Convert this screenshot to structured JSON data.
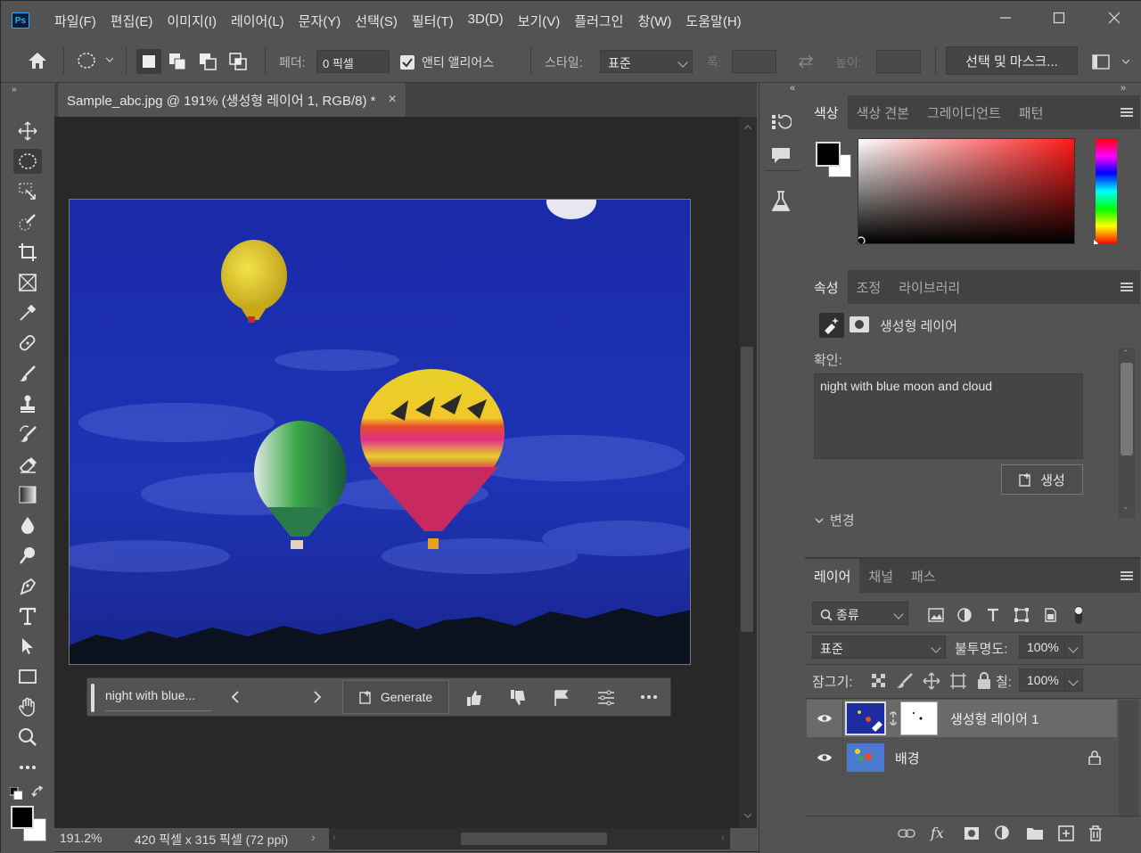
{
  "app": {
    "logo": "Ps",
    "menu": [
      "파일(F)",
      "편집(E)",
      "이미지(I)",
      "레이어(L)",
      "문자(Y)",
      "선택(S)",
      "필터(T)",
      "3D(D)",
      "보기(V)",
      "플러그인",
      "창(W)",
      "도움말(H)"
    ]
  },
  "options": {
    "feather_label": "페더:",
    "feather_value": "0 픽셀",
    "antialias_label": "앤티 앨리어스",
    "antialias_checked": true,
    "style_label": "스타일:",
    "style_value": "표준",
    "width_label": "폭:",
    "height_label": "높이:",
    "select_mask_button": "선택 및 마스크..."
  },
  "document": {
    "tab_title": "Sample_abc.jpg @ 191% (생성형 레이어 1, RGB/8) *",
    "zoom": "191.2%",
    "info": "420 픽셀 x 315 픽셀 (72 ppi)"
  },
  "generative_bar": {
    "prompt": "night with blue...",
    "generate_label": "Generate"
  },
  "color_panel": {
    "tabs": [
      "색상",
      "색상 견본",
      "그레이디언트",
      "패턴"
    ],
    "active_tab": 0,
    "hue_color": "#ff1a1a"
  },
  "properties_panel": {
    "tabs": [
      "속성",
      "조정",
      "라이브러리"
    ],
    "active_tab": 0,
    "layer_type": "생성형 레이어",
    "prompt_label": "확인:",
    "prompt_text": "night with blue moon and cloud",
    "generate_button": "생성",
    "variations_label": "변경"
  },
  "layers_panel": {
    "tabs": [
      "레이어",
      "채널",
      "패스"
    ],
    "active_tab": 0,
    "filter_label": "종류",
    "blend_mode": "표준",
    "opacity_label": "불투명도:",
    "opacity_value": "100%",
    "lock_label": "잠그기:",
    "fill_label": "칠:",
    "fill_value": "100%",
    "layers": [
      {
        "name": "생성형 레이어 1",
        "visible": true,
        "selected": true
      },
      {
        "name": "배경",
        "visible": true,
        "locked": true
      }
    ]
  }
}
